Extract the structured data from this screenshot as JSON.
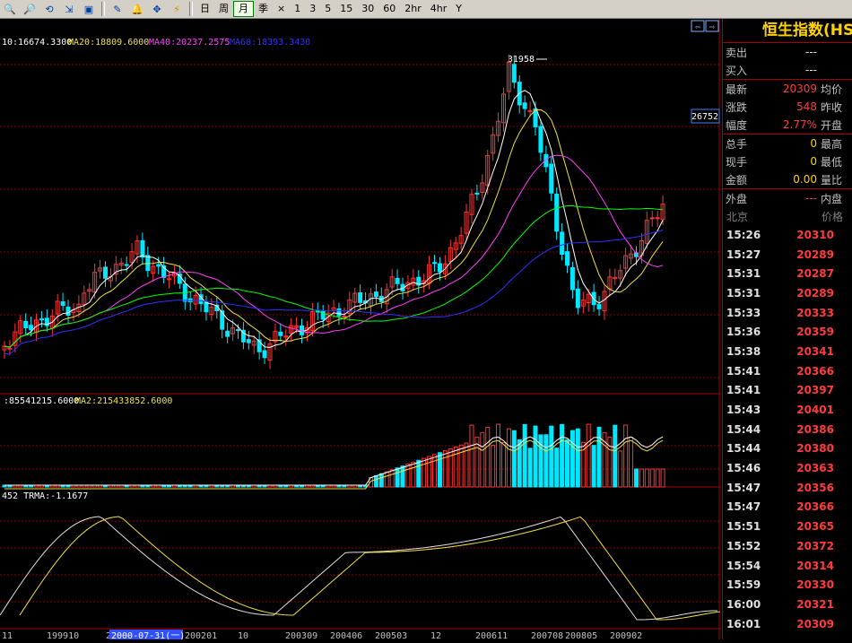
{
  "toolbar": {
    "icons": [
      "zoom-in-icon",
      "zoom-out-icon",
      "restore-icon",
      "export-icon",
      "window-icon",
      "draw-icon",
      "alarm-icon",
      "pinned-icon",
      "lightning-icon"
    ],
    "periods": [
      "日",
      "周",
      "月",
      "季",
      "×",
      "1",
      "3",
      "5",
      "15",
      "30",
      "60",
      "2hr",
      "4hr",
      "Y"
    ],
    "active_period": "月",
    "nav_arrows": [
      "⇦",
      "⇨"
    ]
  },
  "indicators": {
    "ma_line": {
      "prefix": "10:16674.3300",
      "ma20": "MA20:18809.6000",
      "ma40": "MA40:20237.2575",
      "ma60": "MA60:18393.3430"
    },
    "volume_line": {
      "ma1": ":85541215.6000",
      "ma2": "MA2:215433852.6000"
    },
    "trix_line": "452 TRMA:-1.1677",
    "peak_label": "31958",
    "cursor_price": "26752"
  },
  "x_axis": {
    "labels": [
      "11",
      "199910",
      "200",
      "10",
      "200309",
      "200406",
      "200503",
      "12",
      "200611",
      "200708",
      "200805",
      "200902"
    ],
    "cursor_date": "2000-07-31(一)",
    "cursor_after": "200201"
  },
  "colors": {
    "up": "#ff3333",
    "down": "#00e8ff",
    "ma10": "#ffffff",
    "ma20": "#f0e040",
    "ma40": "#ff40ff",
    "ma60": "#00ff00",
    "ma_blue": "#3030ff",
    "grid": "#8b0000"
  },
  "panel": {
    "title": "恒生指数(HS",
    "rows": [
      {
        "label": "卖出",
        "value": "---",
        "label2": "",
        "color": "#e0e0e0"
      },
      {
        "label": "买入",
        "value": "---",
        "label2": "",
        "color": "#e0e0e0"
      },
      {
        "label": "最新",
        "value": "20309",
        "label2": "均价",
        "color": "#ff3b3b"
      },
      {
        "label": "涨跌",
        "value": "548",
        "label2": "昨收",
        "color": "#ff3b3b"
      },
      {
        "label": "幅度",
        "value": "2.77%",
        "label2": "开盘",
        "color": "#ff3b3b"
      },
      {
        "label": "总手",
        "value": "0",
        "label2": "最高",
        "color": "#ffd200"
      },
      {
        "label": "现手",
        "value": "0",
        "label2": "最低",
        "color": "#ffd200"
      },
      {
        "label": "金额",
        "value": "0.00",
        "label2": "量比",
        "color": "#ffd200"
      },
      {
        "label": "外盘",
        "value": "---",
        "label2": "内盘",
        "color": "#ff3b3b"
      }
    ],
    "tick_headers": [
      "北京",
      "价格"
    ],
    "ticks": [
      {
        "time": "15:26",
        "price": "20310"
      },
      {
        "time": "15:27",
        "price": "20289"
      },
      {
        "time": "15:31",
        "price": "20287"
      },
      {
        "time": "15:31",
        "price": "20289"
      },
      {
        "time": "15:33",
        "price": "20333"
      },
      {
        "time": "15:36",
        "price": "20359"
      },
      {
        "time": "15:38",
        "price": "20341"
      },
      {
        "time": "15:41",
        "price": "20366"
      },
      {
        "time": "15:41",
        "price": "20397"
      },
      {
        "time": "15:43",
        "price": "20401"
      },
      {
        "time": "15:44",
        "price": "20386"
      },
      {
        "time": "15:44",
        "price": "20380"
      },
      {
        "time": "15:46",
        "price": "20363"
      },
      {
        "time": "15:47",
        "price": "20356"
      },
      {
        "time": "15:47",
        "price": "20366"
      },
      {
        "time": "15:51",
        "price": "20365"
      },
      {
        "time": "15:52",
        "price": "20372"
      },
      {
        "time": "15:54",
        "price": "20314"
      },
      {
        "time": "15:59",
        "price": "20330"
      },
      {
        "time": "16:00",
        "price": "20321"
      },
      {
        "time": "16:01",
        "price": "20309"
      }
    ]
  }
}
